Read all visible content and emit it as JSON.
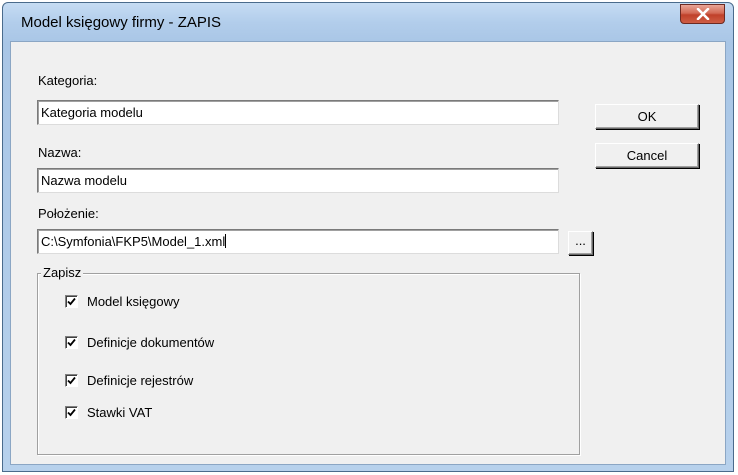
{
  "window": {
    "title": "Model księgowy firmy - ZAPIS"
  },
  "form": {
    "kategoria_label": "Kategoria:",
    "kategoria_value": "Kategoria modelu",
    "nazwa_label": "Nazwa:",
    "nazwa_value": "Nazwa modelu",
    "polozenie_label": "Położenie:",
    "polozenie_value": "C:\\Symfonia\\FKP5\\Model_1.xml",
    "browse_label": "..."
  },
  "buttons": {
    "ok": "OK",
    "cancel": "Cancel"
  },
  "zapisz": {
    "title": "Zapisz",
    "items": [
      {
        "label": "Model księgowy",
        "checked": true
      },
      {
        "label": "Definicje dokumentów",
        "checked": true
      },
      {
        "label": "Definicje rejestrów",
        "checked": true
      },
      {
        "label": "Stawki VAT",
        "checked": true
      }
    ]
  }
}
